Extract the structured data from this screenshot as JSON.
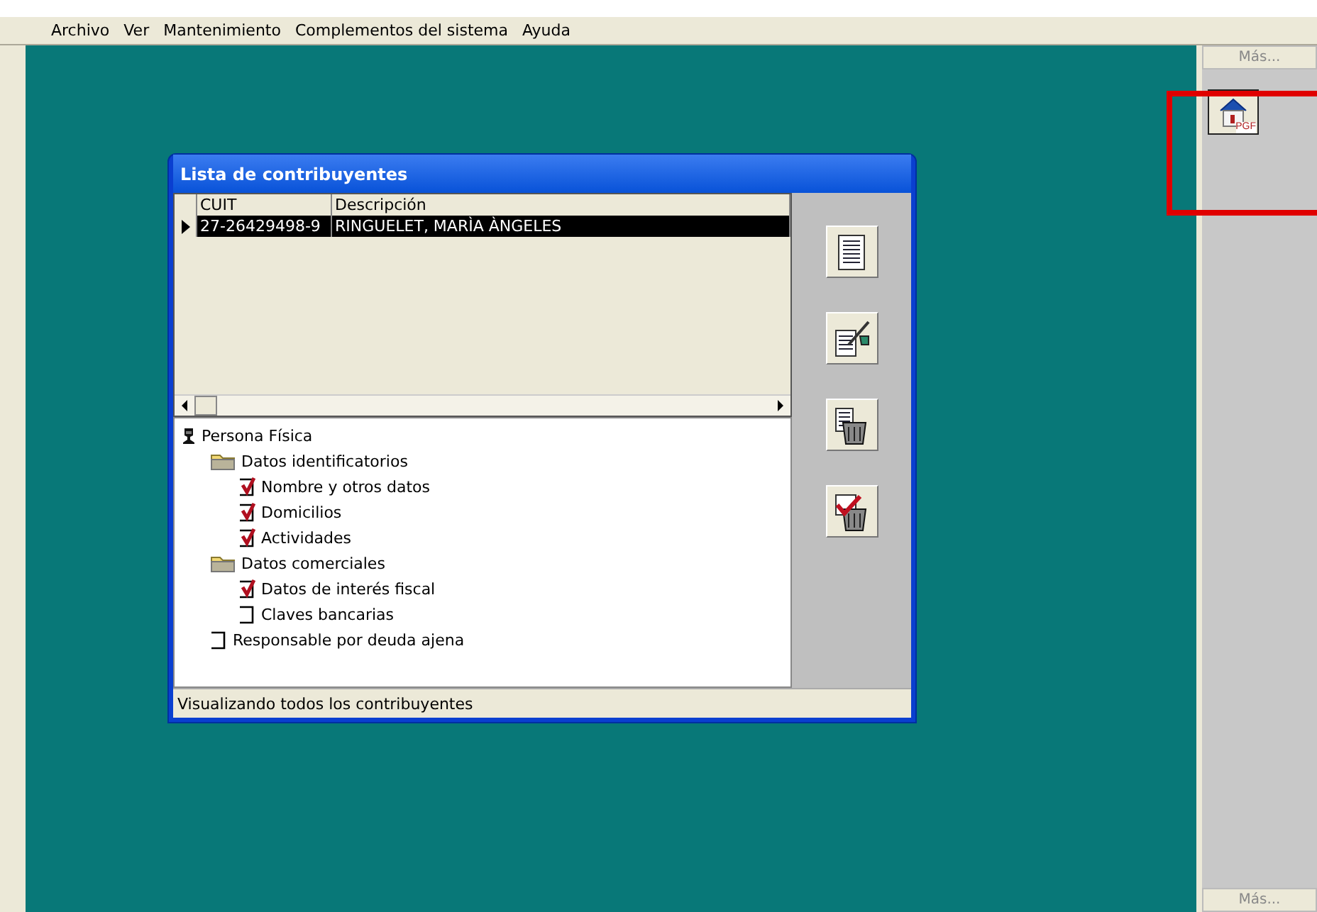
{
  "menu": [
    "Archivo",
    "Ver",
    "Mantenimiento",
    "Complementos del sistema",
    "Ayuda"
  ],
  "side_panel": {
    "top_button": "Más...",
    "bottom_button": "Más...",
    "shortcut": {
      "label": "PGF",
      "highlighted": true
    }
  },
  "window": {
    "title": "Lista de contribuyentes",
    "table": {
      "columns": [
        "CUIT",
        "Descripción"
      ],
      "rows": [
        {
          "cells": [
            "27-26429498-9",
            "RINGUELET, MARÌA ÀNGELES"
          ],
          "selected": true
        }
      ]
    },
    "tree": [
      {
        "label": "Persona Física",
        "kind": "person",
        "children": [
          {
            "label": "Datos identificatorios",
            "kind": "folder",
            "children": [
              {
                "label": "Nombre y otros datos",
                "kind": "check",
                "checked": true
              },
              {
                "label": "Domicilios",
                "kind": "check",
                "checked": true
              },
              {
                "label": "Actividades",
                "kind": "check",
                "checked": true
              }
            ]
          },
          {
            "label": "Datos comerciales",
            "kind": "folder",
            "children": [
              {
                "label": "Datos de interés fiscal",
                "kind": "check",
                "checked": true
              },
              {
                "label": "Claves bancarias",
                "kind": "check",
                "checked": false
              }
            ]
          },
          {
            "label": "Responsable por deuda ajena",
            "kind": "check",
            "checked": false
          }
        ]
      }
    ],
    "actions": [
      {
        "kind": "document"
      },
      {
        "kind": "edit"
      },
      {
        "kind": "delete"
      },
      {
        "kind": "delete-checked"
      }
    ],
    "status": "Visualizando todos los contribuyentes"
  }
}
